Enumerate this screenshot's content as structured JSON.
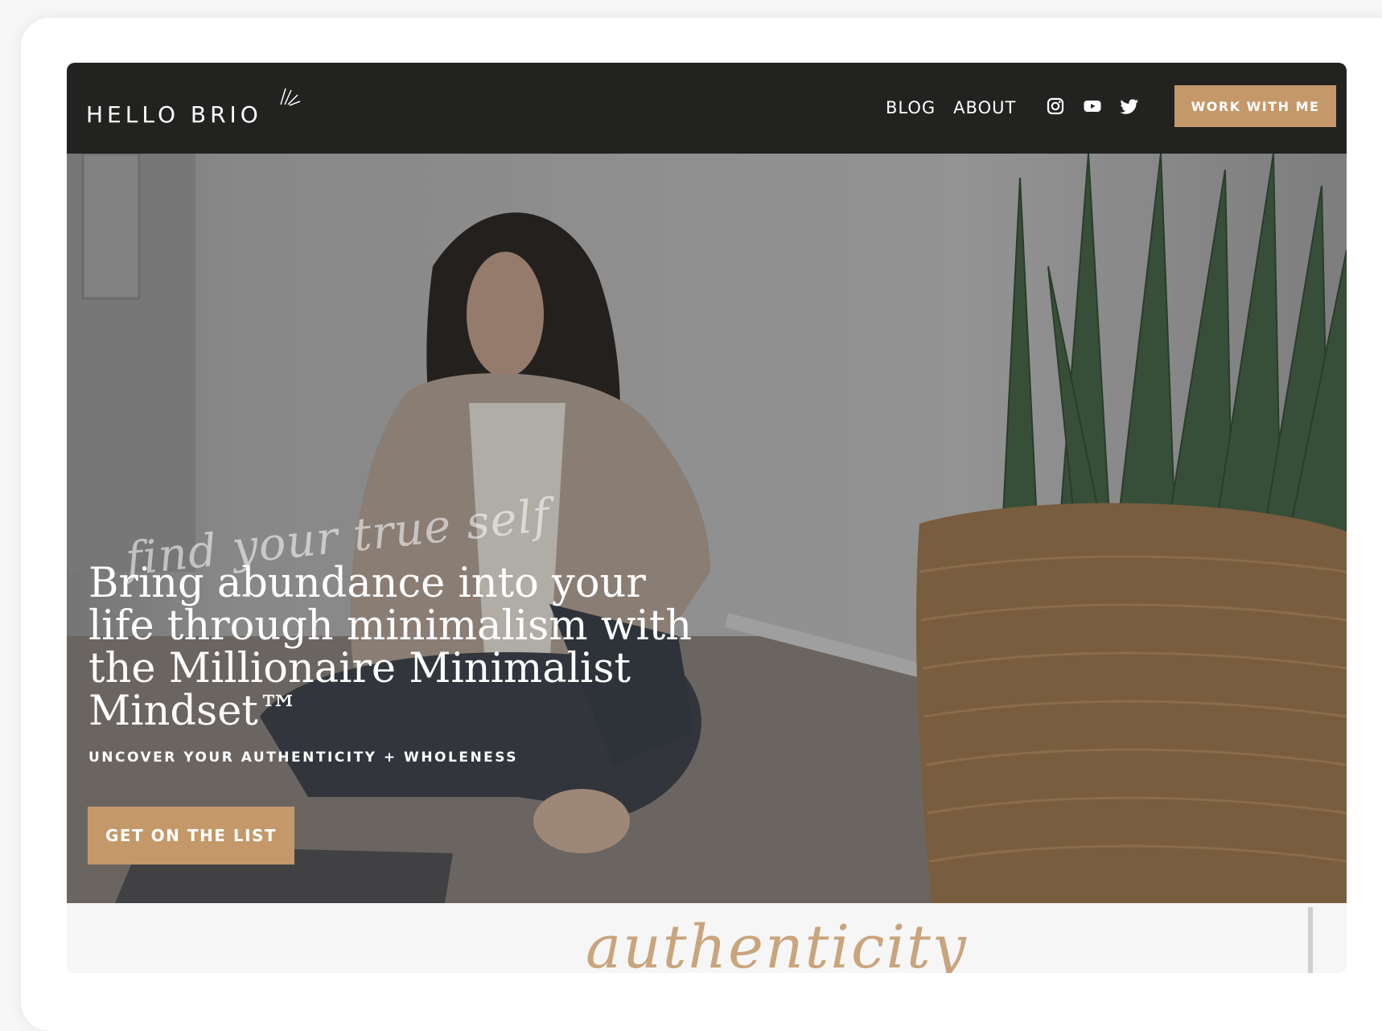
{
  "site": {
    "logo": "HELLO BRIO",
    "nav": {
      "links": [
        "BLOG",
        "ABOUT"
      ],
      "social_icons": [
        "instagram-icon",
        "youtube-icon",
        "twitter-icon"
      ],
      "cta": "WORK WITH ME"
    },
    "hero": {
      "script_tagline": "find your true self",
      "headline": "Bring abundance into your life through minimalism with the Millionaire Minimalist Mindset™",
      "subtitle": "UNCOVER YOUR AUTHENTICITY + WHOLENESS",
      "cta": "GET ON THE LIST"
    },
    "below_fold": {
      "script_text": "authenticity"
    }
  },
  "colors": {
    "nav_bg": "#222221",
    "accent": "#c49869",
    "script": "#c9a47c"
  }
}
